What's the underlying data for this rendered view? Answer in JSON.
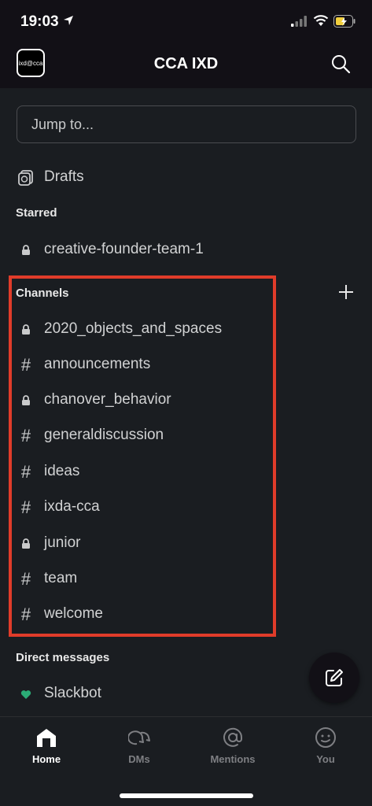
{
  "status": {
    "time": "19:03"
  },
  "header": {
    "title": "CCA IXD",
    "logo_text": "ixd@cca"
  },
  "jump": {
    "placeholder": "Jump to..."
  },
  "drafts": {
    "label": "Drafts"
  },
  "starred": {
    "title": "Starred",
    "items": [
      {
        "label": "creative-founder-team-1",
        "icon": "lock-icon"
      }
    ]
  },
  "channels": {
    "title": "Channels",
    "items": [
      {
        "label": "2020_objects_and_spaces",
        "icon": "lock-icon"
      },
      {
        "label": "announcements",
        "icon": "hash-icon"
      },
      {
        "label": "chanover_behavior",
        "icon": "lock-icon"
      },
      {
        "label": "generaldiscussion",
        "icon": "hash-icon"
      },
      {
        "label": "ideas",
        "icon": "hash-icon"
      },
      {
        "label": "ixda-cca",
        "icon": "hash-icon"
      },
      {
        "label": "junior",
        "icon": "lock-icon"
      },
      {
        "label": "team",
        "icon": "hash-icon"
      },
      {
        "label": "welcome",
        "icon": "hash-icon"
      }
    ]
  },
  "dms": {
    "title": "Direct messages",
    "items": [
      {
        "label": "Slackbot",
        "icon": "heart-icon"
      }
    ]
  },
  "tabs": [
    {
      "label": "Home",
      "icon": "home-icon",
      "active": true
    },
    {
      "label": "DMs",
      "icon": "dms-icon",
      "active": false
    },
    {
      "label": "Mentions",
      "icon": "at-icon",
      "active": false
    },
    {
      "label": "You",
      "icon": "face-icon",
      "active": false
    }
  ],
  "colors": {
    "highlight": "#e03c2a",
    "background": "#1a1d21",
    "slackbot_heart": "#2bac76"
  }
}
